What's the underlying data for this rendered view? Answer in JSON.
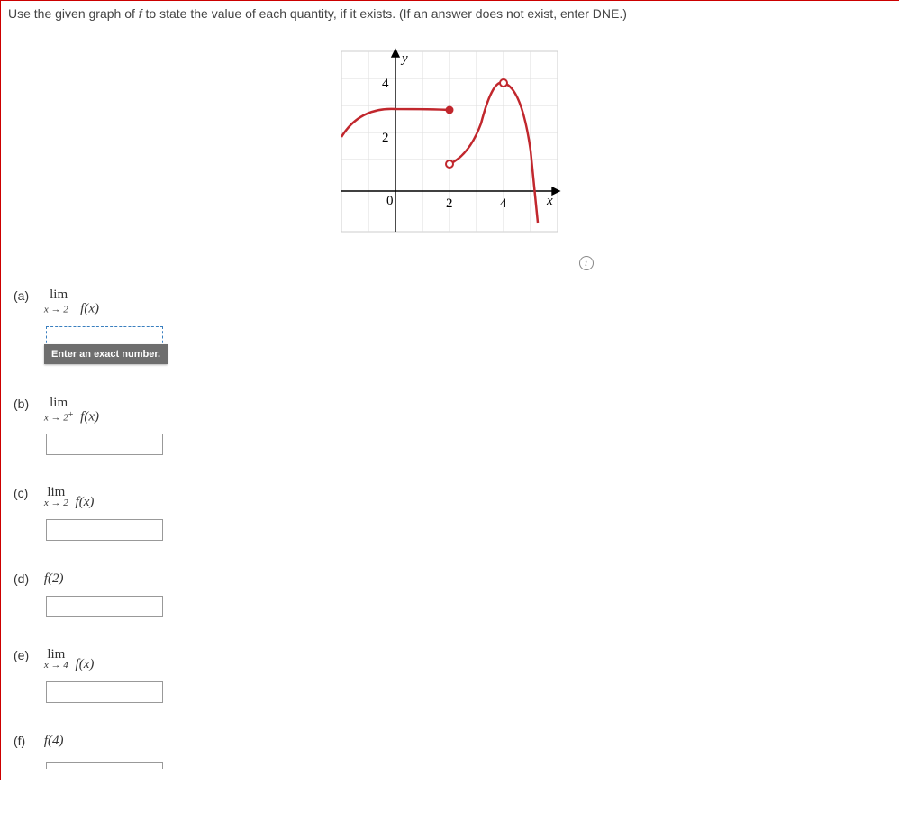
{
  "prompt": {
    "preText": "Use the given graph of ",
    "fn": "f",
    "postText": " to state the value of each quantity, if it exists. (If an answer does not exist, enter DNE.)"
  },
  "tooltip": "Enter an exact number.",
  "infoIcon": "i",
  "questions": {
    "a": {
      "label": "(a)",
      "lim": "lim",
      "sub": "x → 2",
      "sup": "−",
      "rhs": "f(x)"
    },
    "b": {
      "label": "(b)",
      "lim": "lim",
      "sub": "x → 2",
      "sup": "+",
      "rhs": "f(x)"
    },
    "c": {
      "label": "(c)",
      "lim": "lim",
      "sub": "x → 2",
      "sup": "",
      "rhs": "f(x)"
    },
    "d": {
      "label": "(d)",
      "expr": "f(2)"
    },
    "e": {
      "label": "(e)",
      "lim": "lim",
      "sub": "x → 4",
      "sup": "",
      "rhs": "f(x)"
    },
    "f": {
      "label": "(f)",
      "expr": "f(4)"
    }
  },
  "chart_data": {
    "type": "line",
    "title": "",
    "xlabel": "x",
    "ylabel": "y",
    "xlim": [
      -2,
      6
    ],
    "ylim": [
      -1,
      5
    ],
    "xticks": [
      0,
      2,
      4
    ],
    "yticks": [
      0,
      2,
      4
    ],
    "grid": true,
    "series": [
      {
        "name": "branch1",
        "x": [
          -2,
          -1,
          0,
          1,
          2
        ],
        "y": [
          2,
          2.8,
          3,
          3.1,
          3
        ],
        "style": "solid"
      },
      {
        "name": "branch2",
        "x": [
          2,
          2.5,
          3,
          3.5,
          4,
          4.5,
          5,
          5.5
        ],
        "y": [
          1,
          1.3,
          2,
          3,
          4,
          3.5,
          2,
          0
        ],
        "style": "solid"
      }
    ],
    "points": [
      {
        "x": 2,
        "y": 3,
        "kind": "filled"
      },
      {
        "x": 2,
        "y": 1,
        "kind": "open"
      },
      {
        "x": 4,
        "y": 4,
        "kind": "open"
      }
    ]
  }
}
